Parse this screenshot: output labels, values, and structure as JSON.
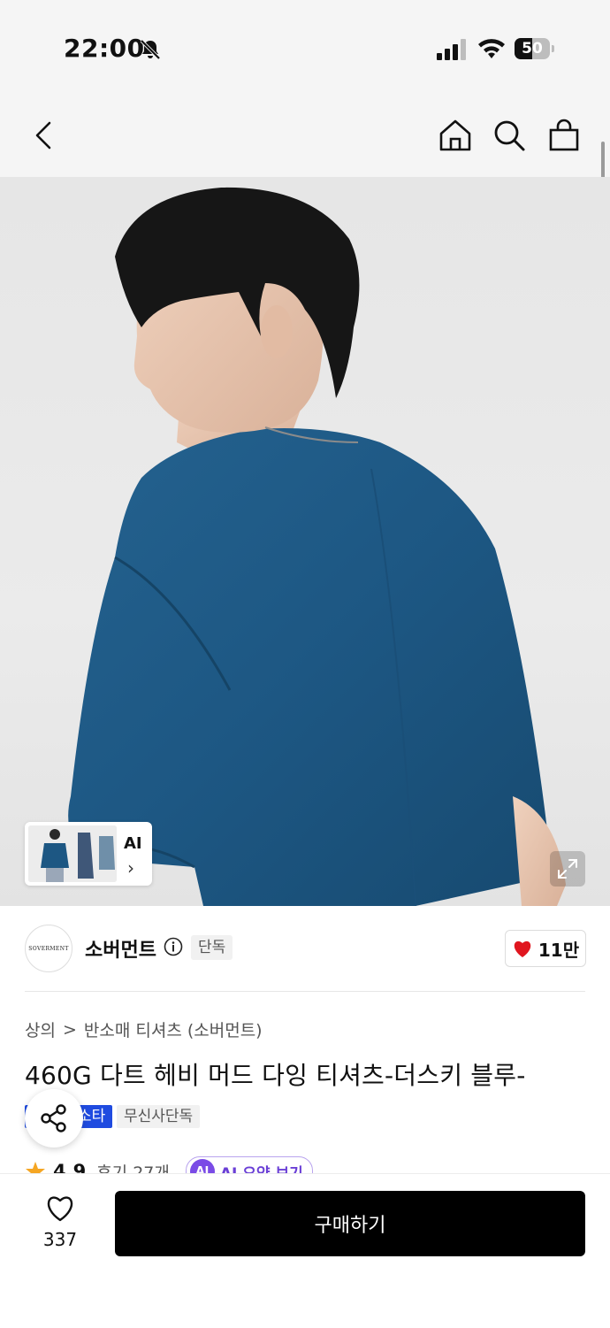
{
  "status_bar": {
    "time": "22:00",
    "battery": "50",
    "battery_level": 0.5
  },
  "nav": {
    "back_icon": "chevron-left-icon",
    "home_icon": "home-icon",
    "search_icon": "search-icon",
    "cart_icon": "shopping-bag-icon"
  },
  "hero": {
    "ai_label": "AI"
  },
  "brand": {
    "name": "소버먼트",
    "logo_text": "SOVERMENT",
    "exclusive_tag": "단독",
    "likes": "11만"
  },
  "breadcrumb": {
    "category": "상의",
    "separator": ">",
    "subcategory": "반소매 티셔츠 (소버먼트)"
  },
  "product": {
    "title": "460G 다트 헤비 머드 다잉 티셔츠-더스키 블루-",
    "tag_blue": "소타",
    "tag_gray": "무신사단독",
    "rating": "4.9",
    "review_count": "후기 27개",
    "ai_badge": "AI",
    "ai_summary": "AI 요약 보기"
  },
  "bottom_bar": {
    "wish_count": "337",
    "buy_label": "구매하기"
  },
  "colors": {
    "accent_blue": "#1f4be0",
    "heart_red": "#e0161f",
    "ai_purple": "#7a4be6",
    "shirt_blue": "#1d5783"
  }
}
